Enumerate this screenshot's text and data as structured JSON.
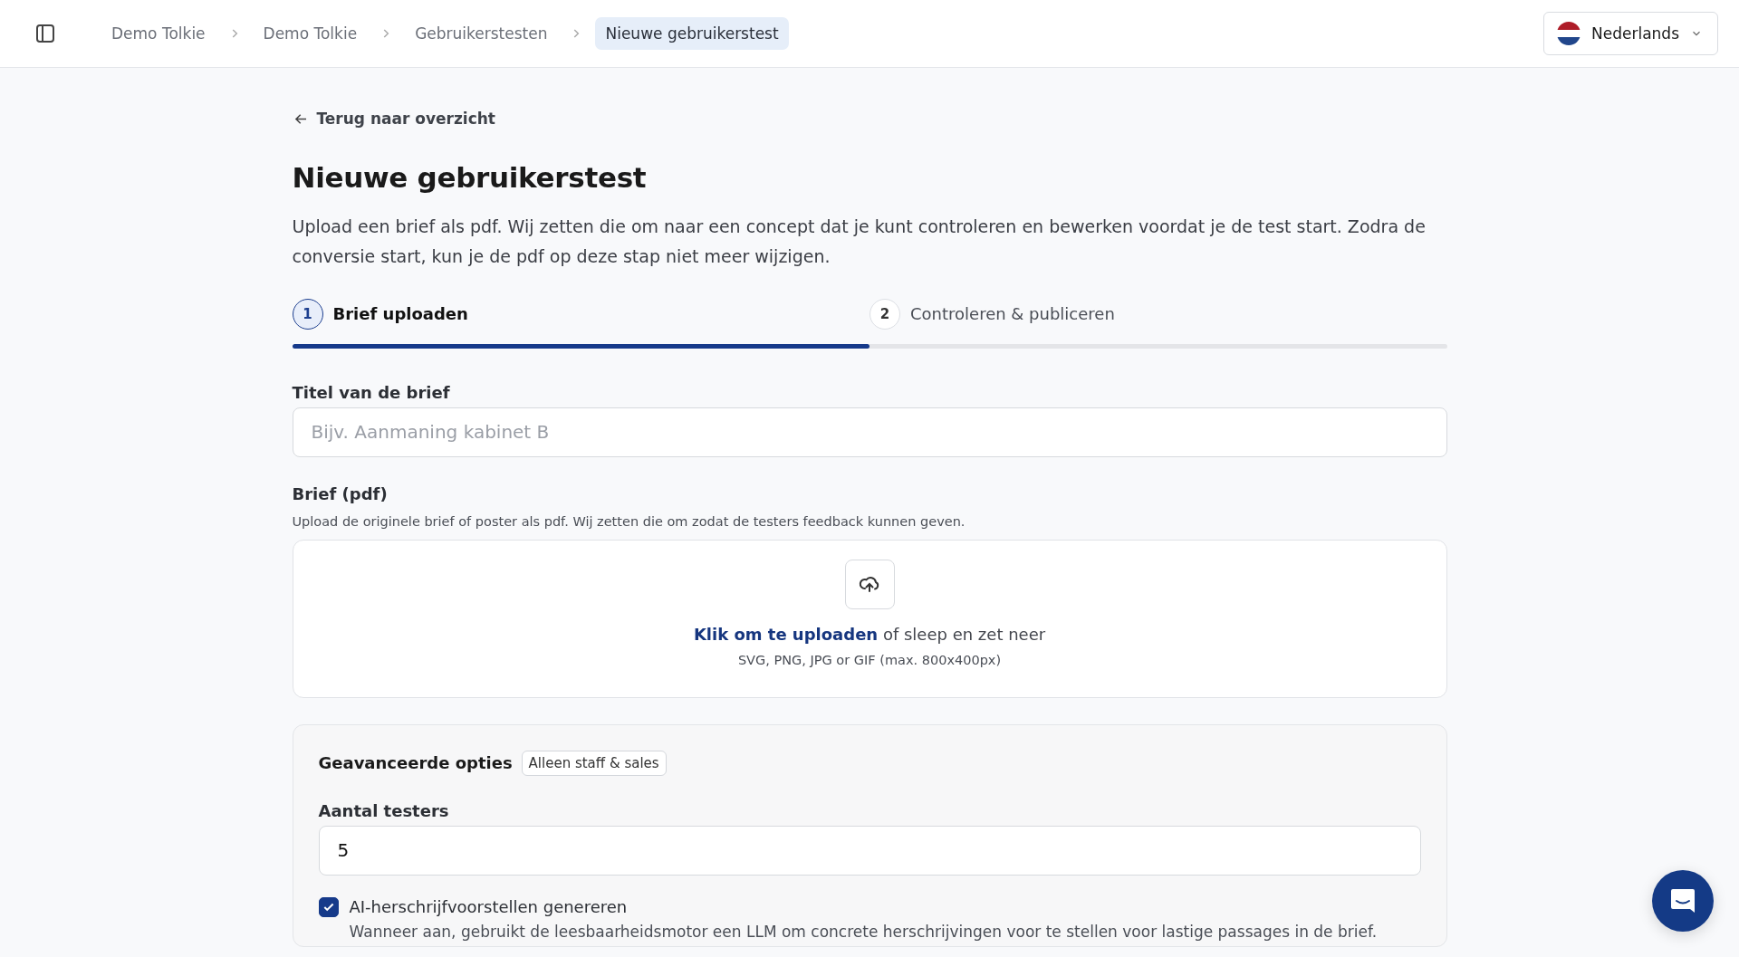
{
  "breadcrumbs": [
    {
      "label": "Demo Tolkie",
      "selected": false
    },
    {
      "label": "Demo Tolkie",
      "selected": false
    },
    {
      "label": "Gebruikerstesten",
      "selected": false
    },
    {
      "label": "Nieuwe gebruikerstest",
      "selected": true
    }
  ],
  "language": {
    "label": "Nederlands"
  },
  "back_link": "Terug naar overzicht",
  "title": "Nieuwe gebruikerstest",
  "intro": "Upload een brief als pdf. Wij zetten die om naar een concept dat je kunt controleren en bewerken voordat je de test start. Zodra de conversie start, kun je de pdf op deze stap niet meer wijzigen.",
  "steps": [
    {
      "number": "1",
      "label": "Brief uploaden",
      "selected": true
    },
    {
      "number": "2",
      "label": "Controleren & publiceren",
      "selected": false
    }
  ],
  "progress": {
    "level": 0.5
  },
  "title_field": {
    "label": "Titel van de brief",
    "placeholder": "Bijv. Aanmaning kabinet B"
  },
  "pdf_field": {
    "label": "Brief (pdf)",
    "help": "Upload de originele brief of poster als pdf. Wij zetten die om zodat de testers feedback kunnen geven.",
    "link": "Klik om te uploaden",
    "rest": "of sleep en zet neer",
    "formats": "SVG, PNG, JPG or GIF (max. 800x400px)"
  },
  "advanced": {
    "title": "Geavanceerde opties",
    "badge": "Alleen staff & sales",
    "testers": {
      "label": "Aantal testers",
      "value": "5"
    },
    "ai_rewrite": {
      "label": "AI-herschrijfvoorstellen genereren",
      "checked": true,
      "description": "Wanneer aan, gebruikt de leesbaarheidsmotor een LLM om concrete herschrijvingen voor te stellen voor lastige passages in de brief."
    }
  }
}
